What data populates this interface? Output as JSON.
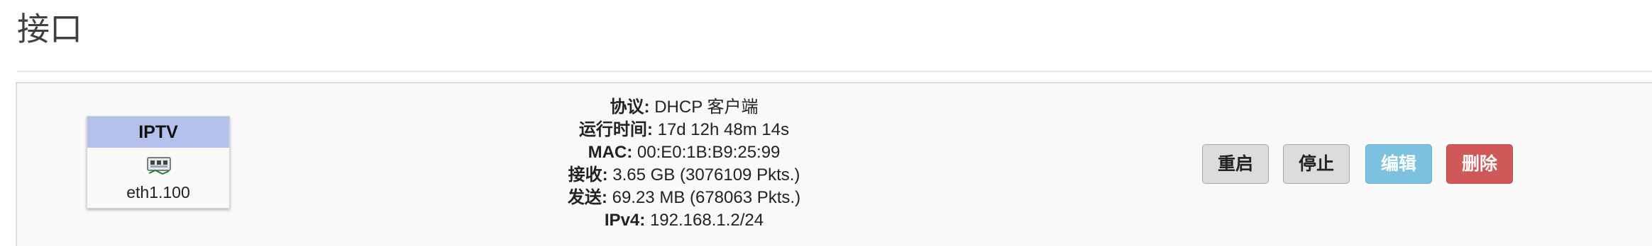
{
  "page": {
    "title": "接口"
  },
  "interface": {
    "name": "IPTV",
    "device": "eth1.100",
    "icon": "ethernet-port-icon",
    "badge_color": "#b3c1ec",
    "info": {
      "protocol_label": "协议:",
      "protocol_value": "DHCP 客户端",
      "uptime_label": "运行时间:",
      "uptime_value": "17d 12h 48m 14s",
      "mac_label": "MAC:",
      "mac_value": "00:E0:1B:B9:25:99",
      "rx_label": "接收:",
      "rx_value": "3.65 GB (3076109 Pkts.)",
      "tx_label": "发送:",
      "tx_value": "69.23 MB (678063 Pkts.)",
      "ipv4_label": "IPv4:",
      "ipv4_value": "192.168.1.2/24"
    },
    "actions": {
      "restart": "重启",
      "stop": "停止",
      "edit": "编辑",
      "delete": "删除"
    },
    "colors": {
      "edit": "#7cc1e0",
      "delete": "#cf5858"
    }
  }
}
